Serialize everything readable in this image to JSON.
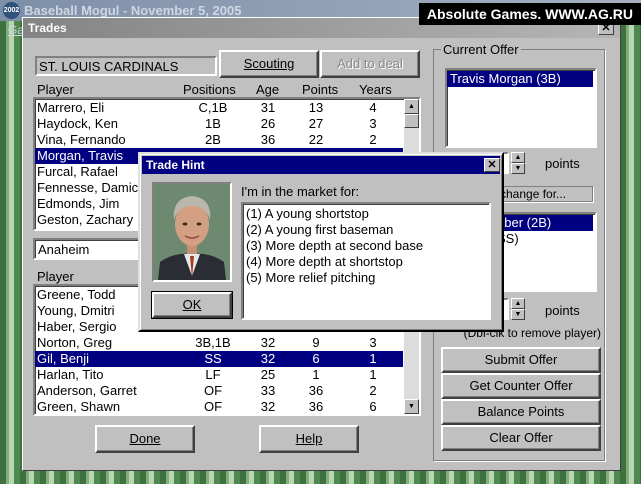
{
  "app": {
    "title": "Baseball Mogul - November 5, 2005",
    "logo_text": "2002",
    "menu_fragment": "Ga",
    "watermark": "Absolute Games. WWW.AG.RU"
  },
  "dialog": {
    "title": "Trades",
    "team1": {
      "name": "ST. LOUIS CARDINALS",
      "scouting_label": "Scouting",
      "add_to_deal_label": "Add to deal",
      "headers": [
        "Player",
        "Positions",
        "Age",
        "Points",
        "Years"
      ],
      "rows": [
        {
          "name": "Marrero, Eli",
          "pos": "C,1B",
          "age": "31",
          "pts": "13",
          "yrs": "4"
        },
        {
          "name": "Haydock, Ken",
          "pos": "1B",
          "age": "26",
          "pts": "27",
          "yrs": "3"
        },
        {
          "name": "Vina, Fernando",
          "pos": "2B",
          "age": "36",
          "pts": "22",
          "yrs": "2"
        },
        {
          "name": "Morgan, Travis",
          "pos": "",
          "age": "",
          "pts": "",
          "yrs": ""
        },
        {
          "name": "Furcal, Rafael",
          "pos": "",
          "age": "",
          "pts": "",
          "yrs": ""
        },
        {
          "name": "Fennesse, Damic",
          "pos": "",
          "age": "",
          "pts": "",
          "yrs": ""
        },
        {
          "name": "Edmonds, Jim",
          "pos": "",
          "age": "",
          "pts": "",
          "yrs": ""
        },
        {
          "name": "Geston, Zachary",
          "pos": "",
          "age": "",
          "pts": "",
          "yrs": ""
        }
      ]
    },
    "team2": {
      "name": "Anaheim",
      "headers": [
        "Player"
      ],
      "rows": [
        {
          "name": "Greene, Todd",
          "pos": "",
          "age": "",
          "pts": "",
          "yrs": ""
        },
        {
          "name": "Young, Dmitri",
          "pos": "",
          "age": "",
          "pts": "",
          "yrs": ""
        },
        {
          "name": "Haber, Sergio",
          "pos": "",
          "age": "",
          "pts": "",
          "yrs": ""
        },
        {
          "name": "Norton, Greg",
          "pos": "3B,1B",
          "age": "32",
          "pts": "9",
          "yrs": "3"
        },
        {
          "name": "Gil, Benji",
          "pos": "SS",
          "age": "32",
          "pts": "6",
          "yrs": "1"
        },
        {
          "name": "Harlan, Tito",
          "pos": "LF",
          "age": "25",
          "pts": "1",
          "yrs": "1"
        },
        {
          "name": "Anderson, Garret",
          "pos": "OF",
          "age": "33",
          "pts": "36",
          "yrs": "2"
        },
        {
          "name": "Green, Shawn",
          "pos": "OF",
          "age": "32",
          "pts": "36",
          "yrs": "6"
        }
      ]
    },
    "current_offer": {
      "label": "Current Offer",
      "offer_items": [
        "Travis Morgan (3B)"
      ],
      "points_label": "points",
      "exchange_label": "change for...",
      "exchange_items": [
        "aber (2B)",
        "SS)"
      ],
      "remove_hint": "(Dbl-clk to remove player)"
    },
    "buttons": {
      "submit": "Submit Offer",
      "counter": "Get Counter Offer",
      "balance": "Balance Points",
      "clear": "Clear Offer",
      "done": "Done",
      "help": "Help"
    }
  },
  "hint": {
    "title": "Trade Hint",
    "intro": "I'm in the market for:",
    "items": [
      "(1) A young shortstop",
      "(2) A young first baseman",
      "(3) More depth at second base",
      "(4) More depth at shortstop",
      "(5) More relief pitching"
    ],
    "ok_label": "OK"
  },
  "colors": {
    "selection": "#000080",
    "dialog_face": "#c0c0c0"
  }
}
